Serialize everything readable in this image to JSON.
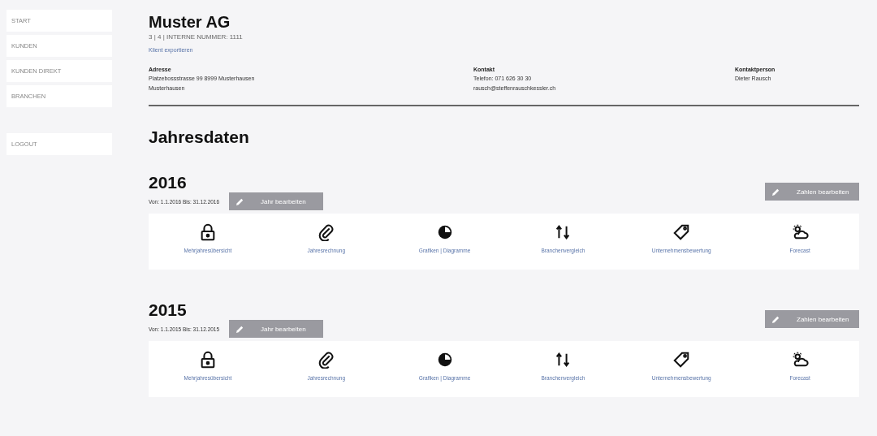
{
  "sidebar": {
    "items": [
      {
        "label": "START"
      },
      {
        "label": "KUNDEN"
      },
      {
        "label": "KUNDEN DIREKT"
      },
      {
        "label": "BRANCHEN"
      }
    ],
    "logout": "LOGOUT"
  },
  "client": {
    "name": "Muster AG",
    "subtitle": "3 | 4 | INTERNE NUMMER: 1111",
    "export_link": "Klient exportieren",
    "info": [
      {
        "label": "Adresse",
        "lines": [
          "Platzebossstrasse 99 8999 Musterhausen",
          "Musterhausen"
        ]
      },
      {
        "label": "Kontakt",
        "lines": [
          "Telefon: 071 626 30 30",
          "rausch@steffenrauschkessler.ch"
        ]
      },
      {
        "label": "Kontaktperson",
        "lines": [
          "Dieter Rausch"
        ]
      }
    ]
  },
  "section_title": "Jahresdaten",
  "years": [
    {
      "year": "2016",
      "range": "Von: 1.1.2016 Bis: 31.12.2016",
      "edit_year": "Jahr bearbeiten",
      "edit_numbers": "Zahlen bearbeiten",
      "tiles": [
        {
          "kind": "lock",
          "label": "Mehrjahresübersicht"
        },
        {
          "kind": "paperclip",
          "label": "Jahresrechnung"
        },
        {
          "kind": "pie",
          "label": "Grafiken | Diagramme"
        },
        {
          "kind": "swap",
          "label": "Branchenvergleich"
        },
        {
          "kind": "tag",
          "label": "Unternehmensbewertung"
        },
        {
          "kind": "weather",
          "label": "Forecast"
        }
      ]
    },
    {
      "year": "2015",
      "range": "Von: 1.1.2015 Bis: 31.12.2015",
      "edit_year": "Jahr bearbeiten",
      "edit_numbers": "Zahlen bearbeiten",
      "tiles": [
        {
          "kind": "lock",
          "label": "Mehrjahresübersicht"
        },
        {
          "kind": "paperclip",
          "label": "Jahresrechnung"
        },
        {
          "kind": "pie",
          "label": "Grafiken | Diagramme"
        },
        {
          "kind": "swap",
          "label": "Branchenvergleich"
        },
        {
          "kind": "tag",
          "label": "Unternehmensbewertung"
        },
        {
          "kind": "weather",
          "label": "Forecast"
        }
      ]
    }
  ]
}
